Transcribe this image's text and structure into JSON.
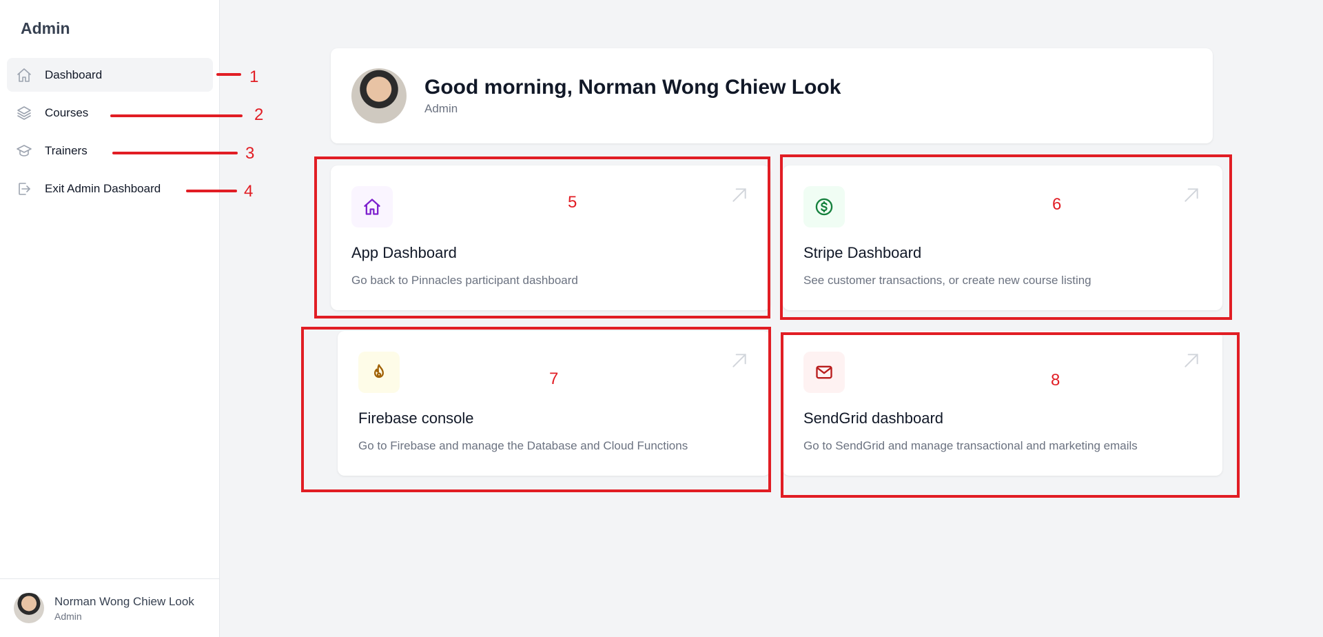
{
  "sidebar": {
    "brand": "Admin",
    "items": [
      {
        "label": "Dashboard",
        "icon": "home-icon",
        "active": true
      },
      {
        "label": "Courses",
        "icon": "layers-icon"
      },
      {
        "label": "Trainers",
        "icon": "graduation-cap-icon"
      },
      {
        "label": "Exit Admin Dashboard",
        "icon": "logout-icon"
      }
    ],
    "user": {
      "name": "Norman Wong Chiew Look",
      "role": "Admin"
    }
  },
  "header": {
    "greeting": "Good morning, Norman Wong Chiew Look",
    "role": "Admin"
  },
  "cards": [
    {
      "title": "App Dashboard",
      "description": "Go back to Pinnacles participant dashboard",
      "icon": "home-icon",
      "icon_color": "#7e22ce",
      "icon_bg": "#faf5ff"
    },
    {
      "title": "Stripe Dashboard",
      "description": "See customer transactions, or create new course listing",
      "icon": "dollar-icon",
      "icon_color": "#15803d",
      "icon_bg": "#f0fdf4"
    },
    {
      "title": "Firebase console",
      "description": "Go to Firebase and manage the Database and Cloud Functions",
      "icon": "flame-icon",
      "icon_color": "#a16207",
      "icon_bg": "#fefce8"
    },
    {
      "title": "SendGrid dashboard",
      "description": "Go to SendGrid and manage transactional and marketing emails",
      "icon": "mail-icon",
      "icon_color": "#b91c1c",
      "icon_bg": "#fef2f2"
    }
  ],
  "annotations": [
    "1",
    "2",
    "3",
    "4",
    "5",
    "6",
    "7",
    "8"
  ],
  "colors": {
    "annotation": "#e11d24",
    "background": "#f3f4f6"
  }
}
